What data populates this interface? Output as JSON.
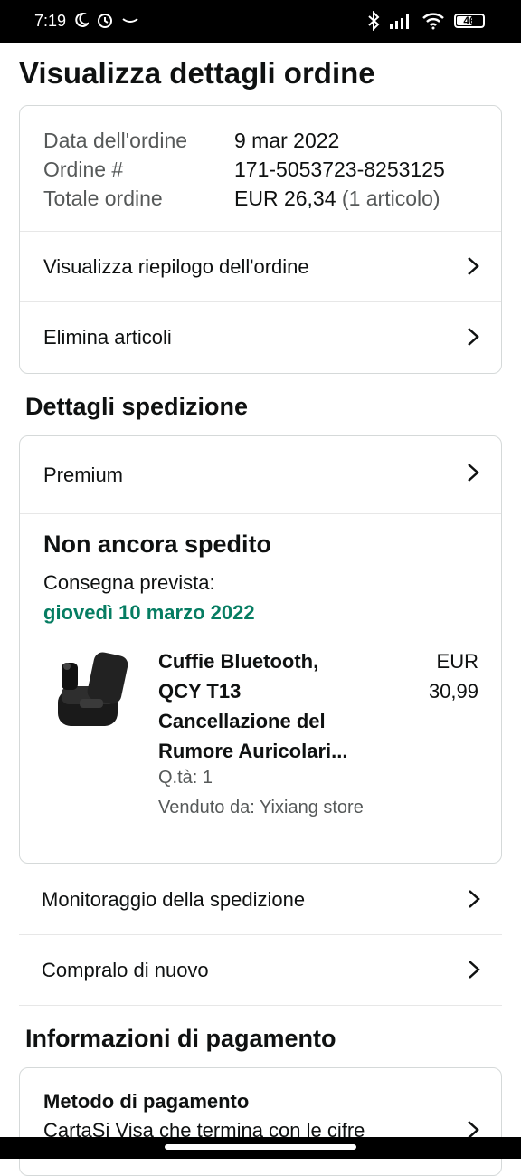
{
  "status": {
    "time": "7:19",
    "battery": "46"
  },
  "page_title": "Visualizza dettagli ordine",
  "order": {
    "date_label": "Data dell'ordine",
    "date_value": "9 mar 2022",
    "number_label": "Ordine #",
    "number_value": "171-5053723-8253125",
    "total_label": "Totale ordine",
    "total_value": "EUR 26,34",
    "total_items": "(1 articolo)"
  },
  "links": {
    "summary": "Visualizza riepilogo dell'ordine",
    "delete": "Elimina articoli"
  },
  "shipping": {
    "section_title": "Dettagli spedizione",
    "method": "Premium",
    "status": "Non ancora spedito",
    "delivery_label": "Consegna prevista:",
    "delivery_date": "giovedì 10 marzo 2022",
    "product": {
      "title_lines": [
        "Cuffie Bluetooth,",
        "QCY T13",
        "Cancellazione del",
        "Rumore Auricolari..."
      ],
      "price_currency": "EUR",
      "price_value": "30,99",
      "quantity": "Q.tà: 1",
      "seller": "Venduto da: Yixiang store"
    },
    "tracking": "Monitoraggio della spedizione",
    "buy_again": "Compralo di nuovo"
  },
  "payment": {
    "section_title": "Informazioni di pagamento",
    "method_title": "Metodo di pagamento",
    "method_desc": "CartaSi Visa che termina con le cifre"
  },
  "icons": {
    "chevron": "chevron-right-icon"
  }
}
